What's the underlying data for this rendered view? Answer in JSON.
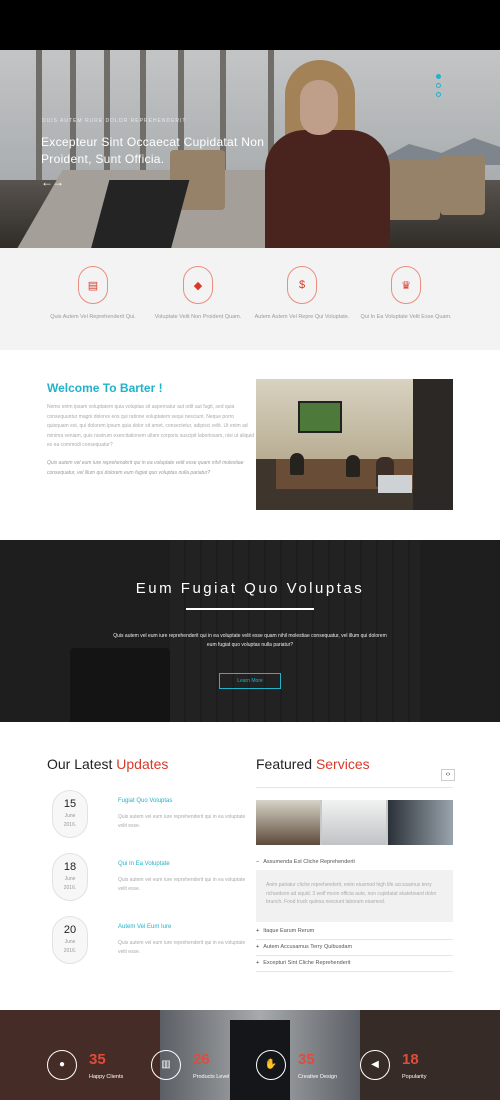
{
  "hero": {
    "small_text": "DUIS AUTEM RURE DOLOR REPREHENDERIT",
    "title": "Excepteur Sint Occaecat Cupidatat Non Proident, Sunt Officia.",
    "arrows": "←→"
  },
  "features": [
    {
      "icon": "document-icon",
      "glyph": "▤",
      "label": "Quis Autem Vel Reprehenderit Qui."
    },
    {
      "icon": "shield-icon",
      "glyph": "◆",
      "label": "Voluptate Velit Non Proident Quam."
    },
    {
      "icon": "dollar-icon",
      "glyph": "$",
      "label": "Autem Autem Vel Repre Qui Voluptate."
    },
    {
      "icon": "award-icon",
      "glyph": "♛",
      "label": "Qui In Ea Voluptate Velit Esse Quam."
    }
  ],
  "welcome": {
    "title": "Welcome To Barter !",
    "p1": "Nemo enim ipsam voluptatem quia voluptas sit aspernatur aut odit aut fugit, sed quia consequuntur magni dolores eos qui ratione voluptatem sequi nesciunt. Neque porro quisquam est, qui dolorem ipsum quia dolor sit amet, consectetur, adipisci velit. Ut enim ad minima veniam, quis nostrum exercitationem ullam corporis suscipit laboriosam, nisi ut aliquid ex ea commodi consequatur?",
    "p2": "Quis autem vel eum iure reprehenderit qui in ea voluptate velit esse quam nihil molestiae consequatur, vel illum qui dolorem eum fugiat quo voluptas nulla pariatur?"
  },
  "parallax": {
    "title": "Eum Fugiat Quo Voluptas",
    "text": "Quis autem vel eum iure reprehenderit qui in ea voluptate velit esse quam nihil molestiae consequatur, vel illum qui dolorem eum fugiat quo voluptas nulla pariatur?",
    "button": "Learn More"
  },
  "updates": {
    "title_a": "Our Latest",
    "title_b": "Updates",
    "items": [
      {
        "day": "15",
        "month": "June",
        "year": "2016.",
        "title": "Fugiat Quo Voluptas",
        "text": "Quis autem vel eum iure reprehenderit qui in ea voluptate velit esse."
      },
      {
        "day": "18",
        "month": "June",
        "year": "2016.",
        "title": "Qui In Ea Voluptate",
        "text": "Quis autem vel eum iure reprehenderit qui in ea voluptate velit esse."
      },
      {
        "day": "20",
        "month": "June",
        "year": "2016.",
        "title": "Autem Vel Eum Iure",
        "text": "Quis autem vel eum iure reprehenderit qui in ea voluptate velit esse."
      }
    ]
  },
  "services": {
    "title_a": "Featured",
    "title_b": "Services",
    "nav": "‹›",
    "open_item": "Assumenda Est Cliche Reprehenderit",
    "open_body": "Anim pariatur cliche reprehenderit, enim eiusmod high life accusamus terry richardson ad squid. 3 wolf moon officia aute, non cupidatat skateboard dolor brunch. Food truck quinoa nesciunt laborum eiusmod.",
    "items": [
      "Itaque Earum Rerum",
      "Autem Accusamus Terry Quibusdam",
      "Excepturi Sint Cliche Reprehenderit"
    ]
  },
  "stats": [
    {
      "icon": "user-icon",
      "glyph": "●",
      "value": "35",
      "label": "Happy Clients"
    },
    {
      "icon": "bar-chart-icon",
      "glyph": "▥",
      "value": "26",
      "label": "Products Level"
    },
    {
      "icon": "thumbs-up-icon",
      "glyph": "✋",
      "value": "35",
      "label": "Creative Design"
    },
    {
      "icon": "megaphone-icon",
      "glyph": "◀",
      "value": "18",
      "label": "Popularity"
    }
  ]
}
